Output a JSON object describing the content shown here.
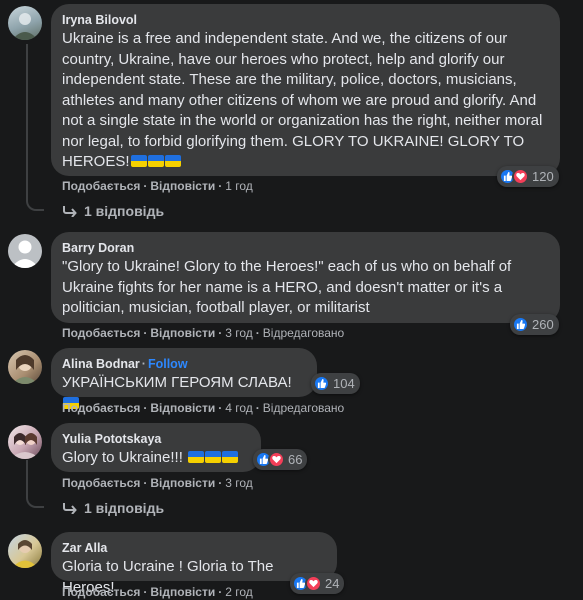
{
  "actions": {
    "like": "Подобається",
    "reply": "Відповісти",
    "separator": "·"
  },
  "comments": [
    {
      "author": "Iryna Bilovol",
      "text": "Ukraine is a free and independent state. And we, the citizens of our country, Ukraine, have our heroes who protect, help and glorify our independent state. These are the military, police, doctors, musicians, athletes and many other citizens of whom we are proud and glorify. And not a single state in the world or organization has the right, neither moral nor legal, to forbid glorifying them. GLORY TO UKRAINE! GLORY TO HEROES!",
      "time": "1 год",
      "reactions": "120",
      "reaction_icons": [
        "like-icon",
        "love-icon"
      ],
      "replies": "1 відповідь"
    },
    {
      "author": "Barry Doran",
      "text": "\"Glory to Ukraine! Glory to the Heroes!\" each of us who on behalf of Ukraine fights for her name is a HERO, and doesn't matter or it's a politician, musician, football player, or militarist",
      "time": "3 год",
      "edited": "Відредаговано",
      "reactions": "260",
      "reaction_icons": [
        "like-icon"
      ]
    },
    {
      "author": "Alina Bodnar",
      "follow": "Follow",
      "text": "УКРАЇНСЬКИМ ГЕРОЯМ СЛАВА!",
      "time": "4 год",
      "edited": "Відредаговано",
      "reactions": "104",
      "reaction_icons": [
        "like-icon"
      ]
    },
    {
      "author": "Yulia Pototskaya",
      "text": "Glory to Ukraine!!!",
      "time": "3 год",
      "reactions": "66",
      "reaction_icons": [
        "like-icon",
        "love-icon"
      ],
      "replies": "1 відповідь"
    },
    {
      "author": "Zar Alla",
      "text": "Gloria to Ucraine ! Gloria to The Heroes!",
      "time": "2 год",
      "reactions": "24",
      "reaction_icons": [
        "like-icon",
        "love-icon"
      ]
    }
  ],
  "colors": {
    "background": "#18191a",
    "bubble": "#3a3b3c",
    "like": "#1877f2",
    "love": "#f33e58",
    "follow": "#2d88ff",
    "flag_blue": "#1f6fdf",
    "flag_yellow": "#f5d000"
  }
}
